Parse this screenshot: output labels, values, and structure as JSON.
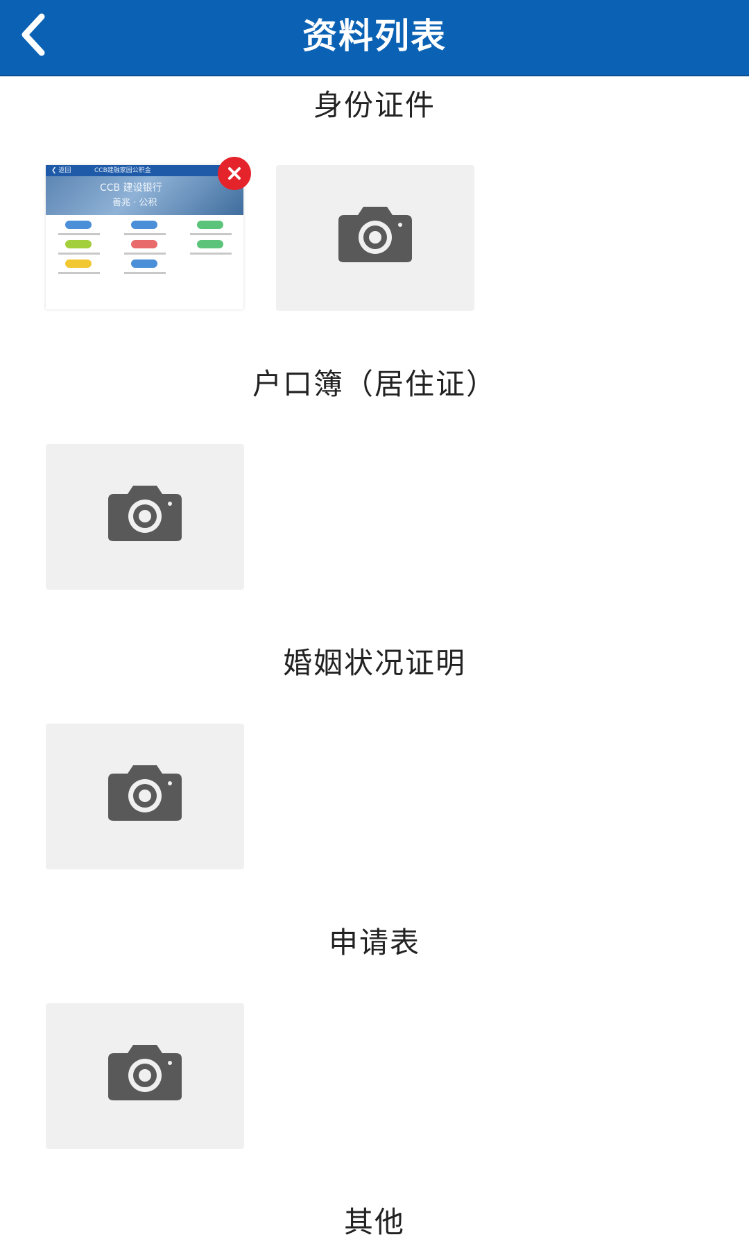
{
  "header": {
    "title": "资料列表",
    "accent_color": "#0b62b4",
    "back_icon": "chevron-left-icon"
  },
  "sections": [
    {
      "title": "身份证件"
    },
    {
      "title": "户口簿（居住证）"
    },
    {
      "title": "婚姻状况证明"
    },
    {
      "title": "申请表"
    },
    {
      "title": "其他"
    }
  ],
  "uploaded_thumbnail": {
    "top_bar_back": "❮ 返回",
    "top_bar_title": "CCB建融家园公积金",
    "banner_line1": "CCB 建设银行",
    "banner_line2": "善兆 · 公积",
    "delete_icon": "close-icon",
    "delete_color": "#e5232b"
  },
  "upload_tile": {
    "icon": "camera-icon",
    "background": "#f0f0f0",
    "icon_color": "#595959"
  }
}
